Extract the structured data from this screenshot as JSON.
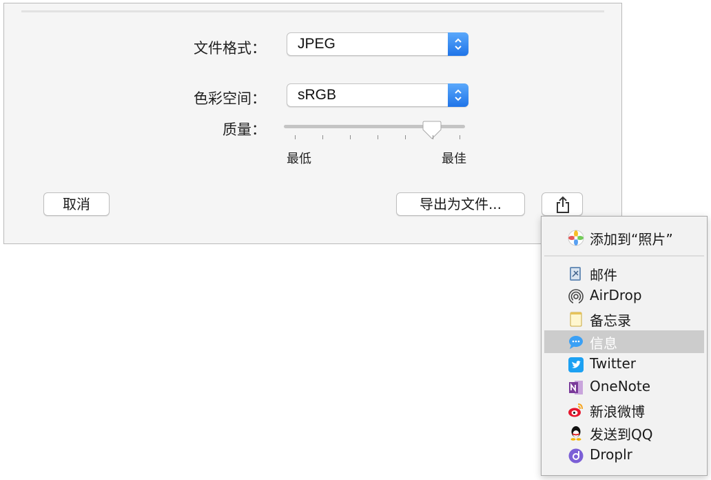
{
  "dialog": {
    "format_label": "文件格式：",
    "format_value": "JPEG",
    "colorspace_label": "色彩空间：",
    "colorspace_value": "sRGB",
    "quality_label": "质量：",
    "quality_level": 0.8,
    "quality_min_label": "最低",
    "quality_max_label": "最佳",
    "cancel_label": "取消",
    "export_label": "导出为文件..."
  },
  "share_icon": "share-icon",
  "share_menu": {
    "top_item": {
      "label": "添加到“照片”",
      "icon": "photos-icon"
    },
    "items": [
      {
        "label": "邮件",
        "icon": "mail-icon"
      },
      {
        "label": "AirDrop",
        "icon": "airdrop-icon"
      },
      {
        "label": "备忘录",
        "icon": "notes-icon"
      },
      {
        "label": "信息",
        "icon": "messages-icon",
        "selected": true
      },
      {
        "label": "Twitter",
        "icon": "twitter-icon"
      },
      {
        "label": "OneNote",
        "icon": "onenote-icon"
      },
      {
        "label": "新浪微博",
        "icon": "weibo-icon"
      },
      {
        "label": "发送到QQ",
        "icon": "qq-icon"
      },
      {
        "label": "Droplr",
        "icon": "droplr-icon"
      }
    ]
  },
  "colors": {
    "accent": "#1f74e8",
    "selected_row": "#cccccc",
    "twitter": "#1da1f2",
    "onenote": "#7a3a9a"
  }
}
